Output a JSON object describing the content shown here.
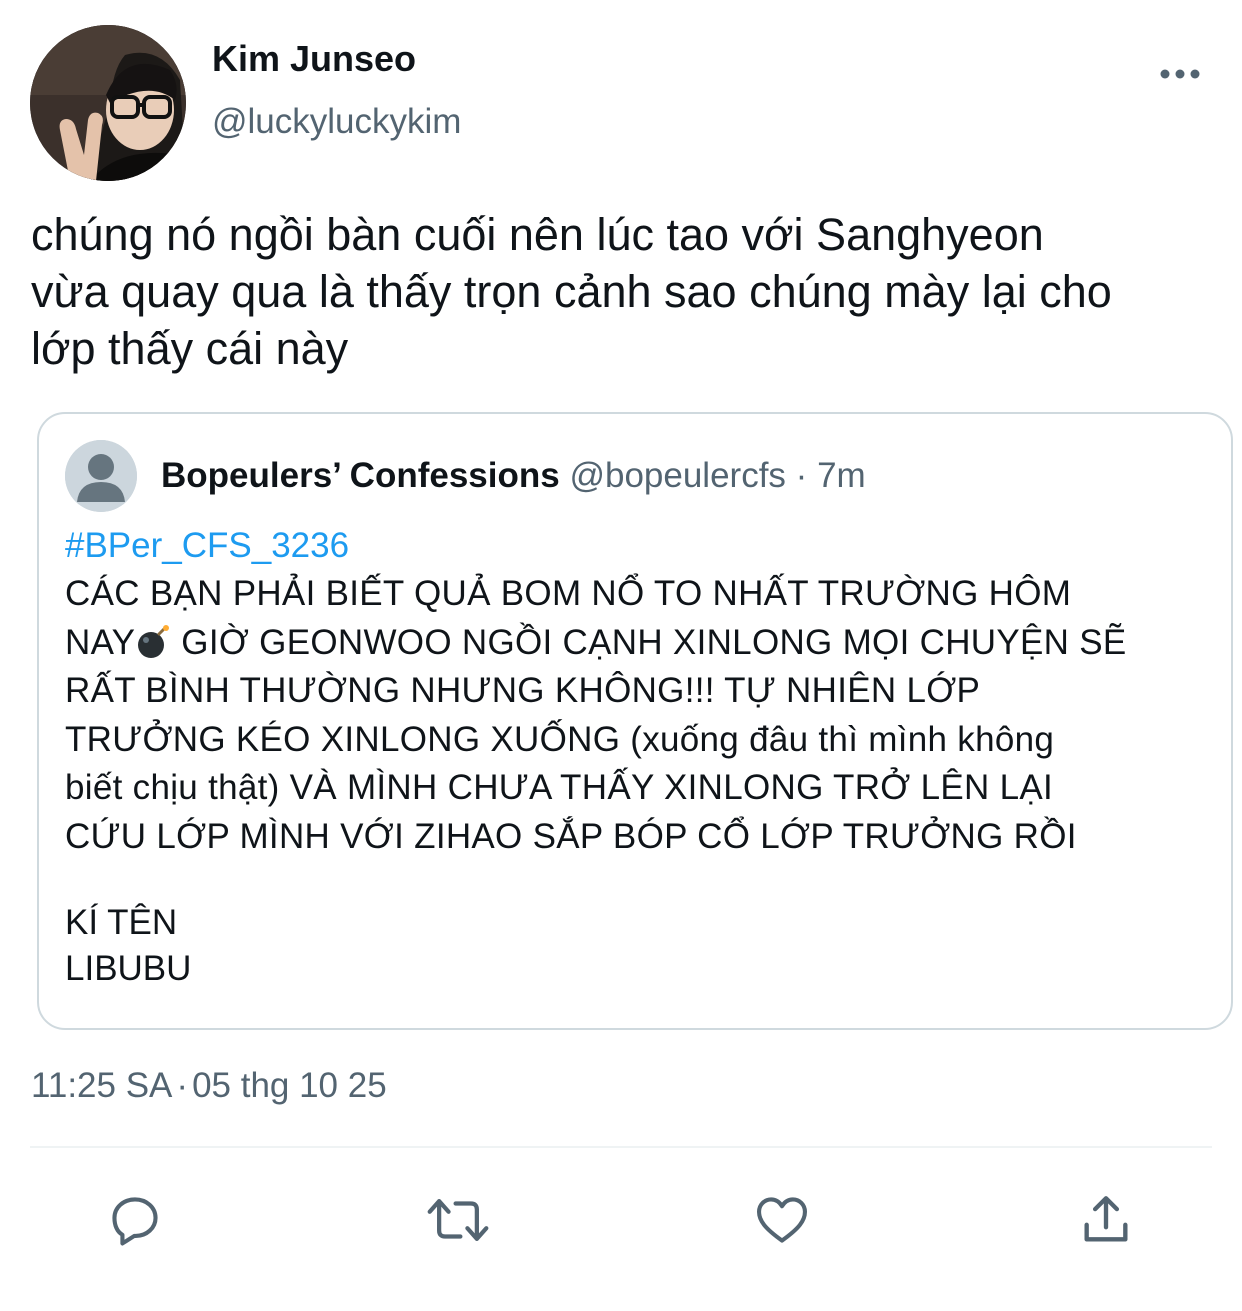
{
  "author": {
    "display_name": "Kim Junseo",
    "handle": "@luckyluckykim",
    "avatar": "profile-photo"
  },
  "more_icon": "more-horizontal-icon",
  "tweet": {
    "text": "chúng nó ngồi bàn cuối nên lúc tao với Sanghyeon\nvừa quay qua là thấy trọn cảnh sao chúng mày lại cho\nlớp thấy cái này",
    "timestamp_time": "11:25 SA",
    "timestamp_sep": "·",
    "timestamp_date": "05 thg 10 25"
  },
  "quoted_tweet": {
    "avatar": "default-avatar-icon",
    "name": "Bopeulers’ Confessions",
    "handle": "@bopeulercfs",
    "sep": "·",
    "time": "7m",
    "hashtag": "#BPer_CFS_3236",
    "lines": {
      "l1": "CÁC BẠN PHẢI BIẾT QUẢ BOM NỔ TO NHẤT TRƯỜNG HÔM",
      "l2_before_emoji": "NAY",
      "l2_emoji": "bomb-emoji",
      "l2_after_emoji": " GIỜ GEONWOO NGỒI CẠNH XINLONG MỌI CHUYỆN SẼ",
      "l3": "RẤT BÌNH THƯỜNG NHƯNG KHÔNG!!! TỰ NHIÊN LỚP",
      "l4": "TRƯỞNG KÉO XINLONG XUỐNG (xuống đâu thì mình không",
      "l5": "biết chịu thật) VÀ MÌNH CHƯA THẤY XINLONG TRỞ LÊN LẠI",
      "l6": "CỨU LỚP MÌNH VỚI ZIHAO SẮP BÓP CỔ LỚP TRƯỞNG RỒI"
    },
    "sign_label": "KÍ TÊN",
    "sign_name": "LIBUBU"
  },
  "actions": {
    "reply_icon": "reply-icon",
    "retweet_icon": "retweet-icon",
    "like_icon": "heart-icon",
    "share_icon": "share-icon"
  },
  "colors": {
    "text_primary": "#0f1419",
    "text_secondary": "#536471",
    "link": "#1d9bf0",
    "border": "#cfd9de"
  }
}
